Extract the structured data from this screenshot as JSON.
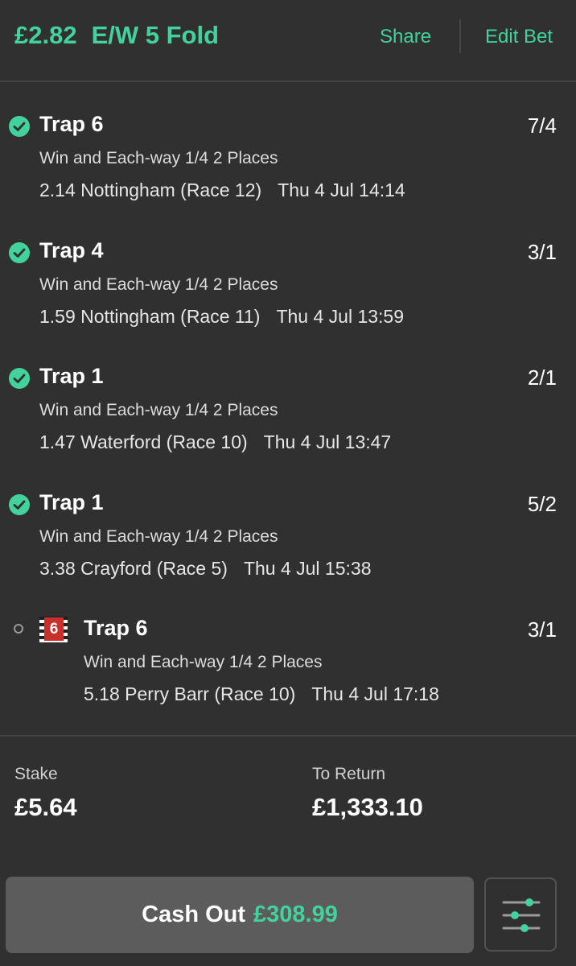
{
  "header": {
    "stake_per_line": "£2.82",
    "bet_type": "E/W 5 Fold",
    "share_label": "Share",
    "edit_label": "Edit Bet"
  },
  "selections": [
    {
      "name": "Trap 6",
      "market": "Win and Each-way 1/4 2 Places",
      "event": "2.14 Nottingham (Race 12)",
      "time": "Thu 4 Jul 14:14",
      "odds": "7/4",
      "status": "won"
    },
    {
      "name": "Trap 4",
      "market": "Win and Each-way 1/4 2 Places",
      "event": "1.59 Nottingham (Race 11)",
      "time": "Thu 4 Jul 13:59",
      "odds": "3/1",
      "status": "won"
    },
    {
      "name": "Trap 1",
      "market": "Win and Each-way 1/4 2 Places",
      "event": "1.47 Waterford (Race 10)",
      "time": "Thu 4 Jul 13:47",
      "odds": "2/1",
      "status": "won"
    },
    {
      "name": "Trap 1",
      "market": "Win and Each-way 1/4 2 Places",
      "event": "3.38 Crayford (Race 5)",
      "time": "Thu 4 Jul 15:38",
      "odds": "5/2",
      "status": "won"
    },
    {
      "name": "Trap 6",
      "market": "Win and Each-way 1/4 2 Places",
      "event": "5.18 Perry Barr (Race 10)",
      "time": "Thu 4 Jul 17:18",
      "odds": "3/1",
      "status": "pending",
      "trap_number": "6"
    }
  ],
  "summary": {
    "stake_label": "Stake",
    "stake_value": "£5.64",
    "return_label": "To Return",
    "return_value": "£1,333.10"
  },
  "cashout": {
    "label": "Cash Out",
    "amount": "£308.99"
  },
  "icons": {
    "status_won": "check-circle-icon",
    "status_pending": "pending-circle-icon",
    "trap_silk": "trap-6-silk-icon",
    "settings": "sliders-icon"
  },
  "colors": {
    "accent": "#43d19e",
    "background": "#2f302f",
    "button": "#5b5c5b",
    "trap6": "#c9302c"
  }
}
